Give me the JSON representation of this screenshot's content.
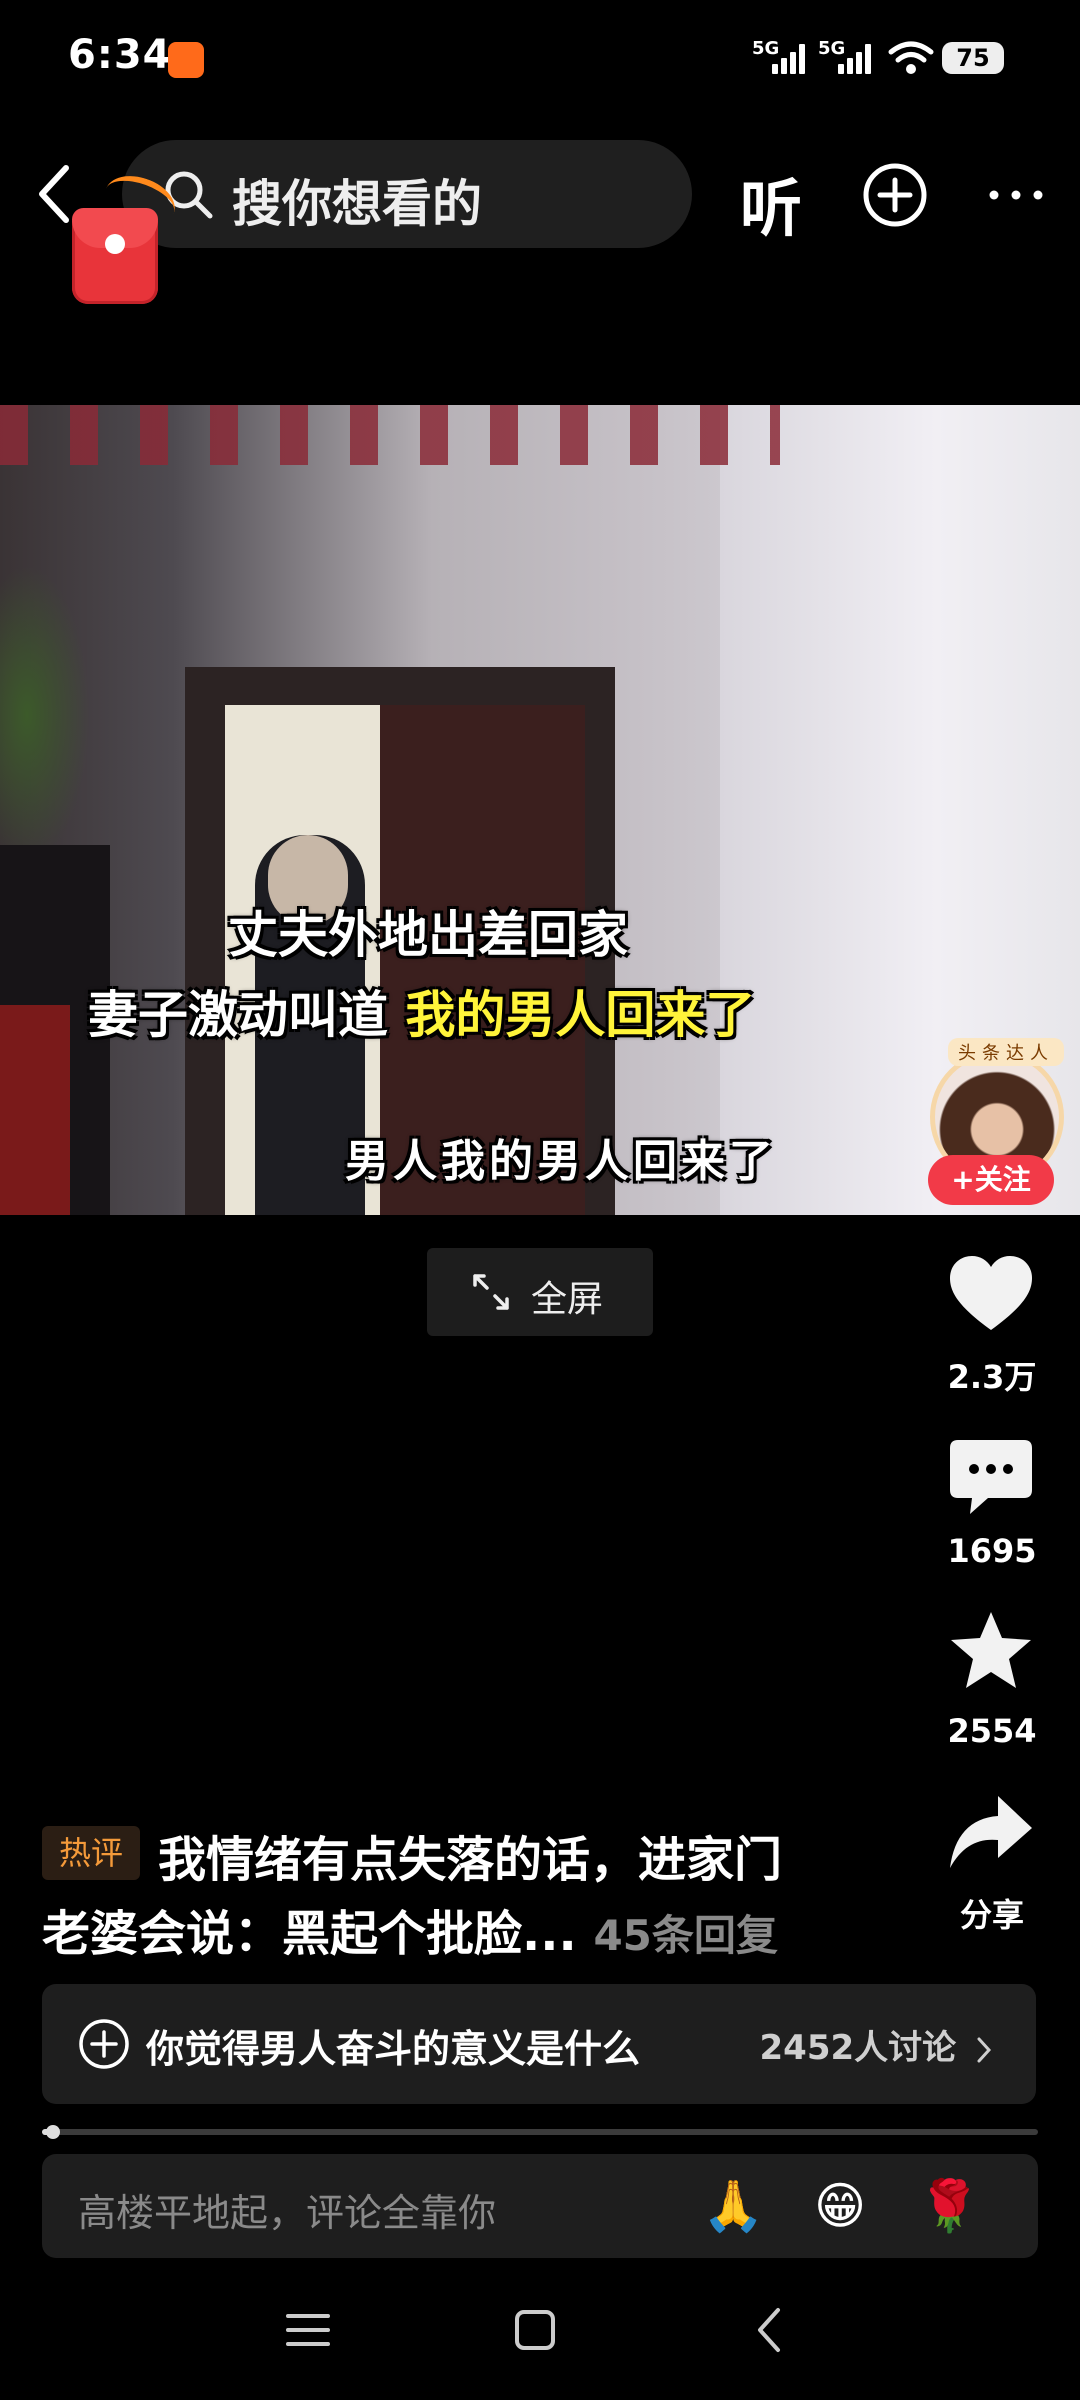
{
  "status_bar": {
    "time": "6:34",
    "signal1_label": "5G",
    "signal2_label": "5G",
    "battery": "75"
  },
  "top_bar": {
    "search_placeholder": "搜你想看的",
    "listen_label": "听",
    "icons": [
      "back-arrow-icon",
      "search-icon",
      "red-packet-icon",
      "plus-circle-icon",
      "more-dots-icon"
    ]
  },
  "video": {
    "subtitle_line1": "丈夫外地出差回家",
    "subtitle_line2_prefix": "妻子激动叫道",
    "subtitle_line2_highlight": "我的男人回来了",
    "caption": "男人我的男人回来了",
    "highlight_color": "#fff43a"
  },
  "creator": {
    "badge": "头条达人",
    "follow_label": "+关注"
  },
  "fullscreen_label": "全屏",
  "actions": {
    "likes": "2.3万",
    "comments": "1695",
    "favorites": "2554",
    "share": "分享"
  },
  "hot_comment": {
    "tag": "热评",
    "line1": "我情绪有点失落的话，进家门",
    "line2": "老婆会说：黑起个批脸...",
    "replies": "45条回复"
  },
  "topic": {
    "text": "你觉得男人奋斗的意义是什么",
    "count": "2452人讨论"
  },
  "playback_progress": 0.01,
  "comment_input": {
    "placeholder": "高楼平地起，评论全靠你",
    "emojis": [
      "🙏",
      "😁",
      "🌹"
    ]
  },
  "colors": {
    "accent_red": "#f23a48",
    "hot_tag_orange": "#f49a3a",
    "background": "#000000"
  }
}
